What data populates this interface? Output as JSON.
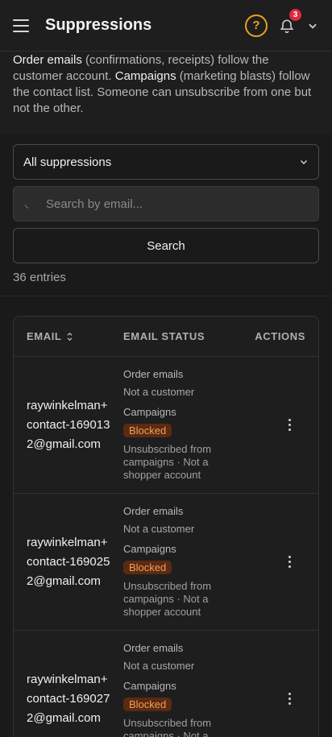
{
  "header": {
    "title": "Suppressions",
    "help_icon": "?",
    "notification_count": "3"
  },
  "intro": {
    "term1": "Order emails",
    "text1": " (confirmations, receipts) follow the customer account. ",
    "term2": "Campaigns",
    "text2": " (marketing blasts) follow the contact list. Someone can unsubscribe from one but not the other."
  },
  "filters": {
    "select_value": "All suppressions",
    "search_placeholder": "Search by email...",
    "search_button": "Search",
    "entries": "36 entries"
  },
  "table": {
    "columns": {
      "email": "EMAIL",
      "status": "EMAIL STATUS",
      "actions": "ACTIONS"
    },
    "rows": [
      {
        "email": "raywinkelman+contact-1690132@gmail.com",
        "order_label": "Order emails",
        "order_value": "Not a customer",
        "campaign_label": "Campaigns",
        "campaign_badge": "Blocked",
        "note": "Unsubscribed from campaigns · Not a shopper account"
      },
      {
        "email": "raywinkelman+contact-1690252@gmail.com",
        "order_label": "Order emails",
        "order_value": "Not a customer",
        "campaign_label": "Campaigns",
        "campaign_badge": "Blocked",
        "note": "Unsubscribed from campaigns · Not a shopper account"
      },
      {
        "email": "raywinkelman+contact-1690272@gmail.com",
        "order_label": "Order emails",
        "order_value": "Not a customer",
        "campaign_label": "Campaigns",
        "campaign_badge": "Blocked",
        "note": "Unsubscribed from campaigns · Not a shopper account"
      }
    ]
  },
  "colors": {
    "accent_help": "#e8a317",
    "badge_red": "#e0293a",
    "blocked_bg": "#5a2a12",
    "blocked_text": "#f0a058"
  },
  "icons": {
    "menu": "hamburger-icon",
    "help": "help-circle-icon",
    "notifications": "bell-icon",
    "account_menu": "chevron-down-icon",
    "select": "chevron-down-icon",
    "search": "search-icon",
    "sort": "sort-icon",
    "row_actions": "kebab-menu-icon"
  }
}
